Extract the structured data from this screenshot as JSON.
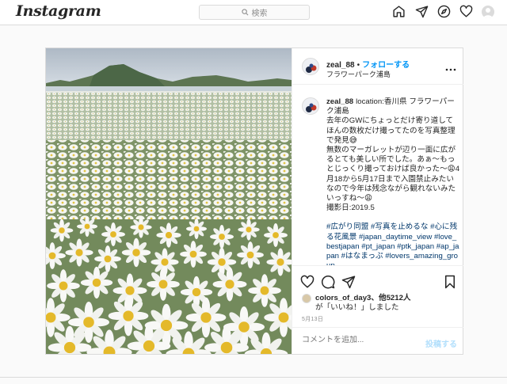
{
  "header": {
    "logo": "Instagram",
    "search_placeholder": "検索",
    "icons": [
      "home-icon",
      "direct-icon",
      "explore-icon",
      "activity-icon",
      "profile-avatar"
    ]
  },
  "post": {
    "username": "zeal_88",
    "separator": "•",
    "follow_label": "フォローする",
    "location": "フラワーパーク浦島",
    "more_icon": "more-options-icon",
    "caption_lines": [
      "location:香川県 フラワーパーク浦島",
      "去年のGWにちょっとだけ寄り道してほんの数枚だけ撮ってたのを写真整理で発見😅",
      "無数のマーガレットが辺り一面に広がるとても美しい所でした。あぁ〜もっとじっくり撮っておけば良かった〜😩4月18から5月17日まで入園禁止みたいなので今年は残念ながら観れないみたいっすね〜😩",
      "撮影日:2019.5"
    ],
    "hashtags": "#広がり同盟 #写真を止めるな #心に残る花風景 #japan_daytime_view #love_bestjapan #pt_japan #ptk_japan #ap_japan #はなまっぷ #lovers_amazing_group",
    "actions": [
      "heart-icon",
      "comment-icon",
      "share-icon",
      "bookmark-icon"
    ],
    "likes_user": "colors_of_day3",
    "likes_rest": "、他5212人",
    "likes_suffix": "が「いいね！」しました",
    "date": "5月13日",
    "comment_placeholder": "コメントを追加...",
    "post_button": "投稿する"
  },
  "colors": {
    "accent": "#0095f6",
    "post_button_disabled": "#b2dffc",
    "hashtag": "#00376b",
    "border": "#dbdbdb"
  }
}
